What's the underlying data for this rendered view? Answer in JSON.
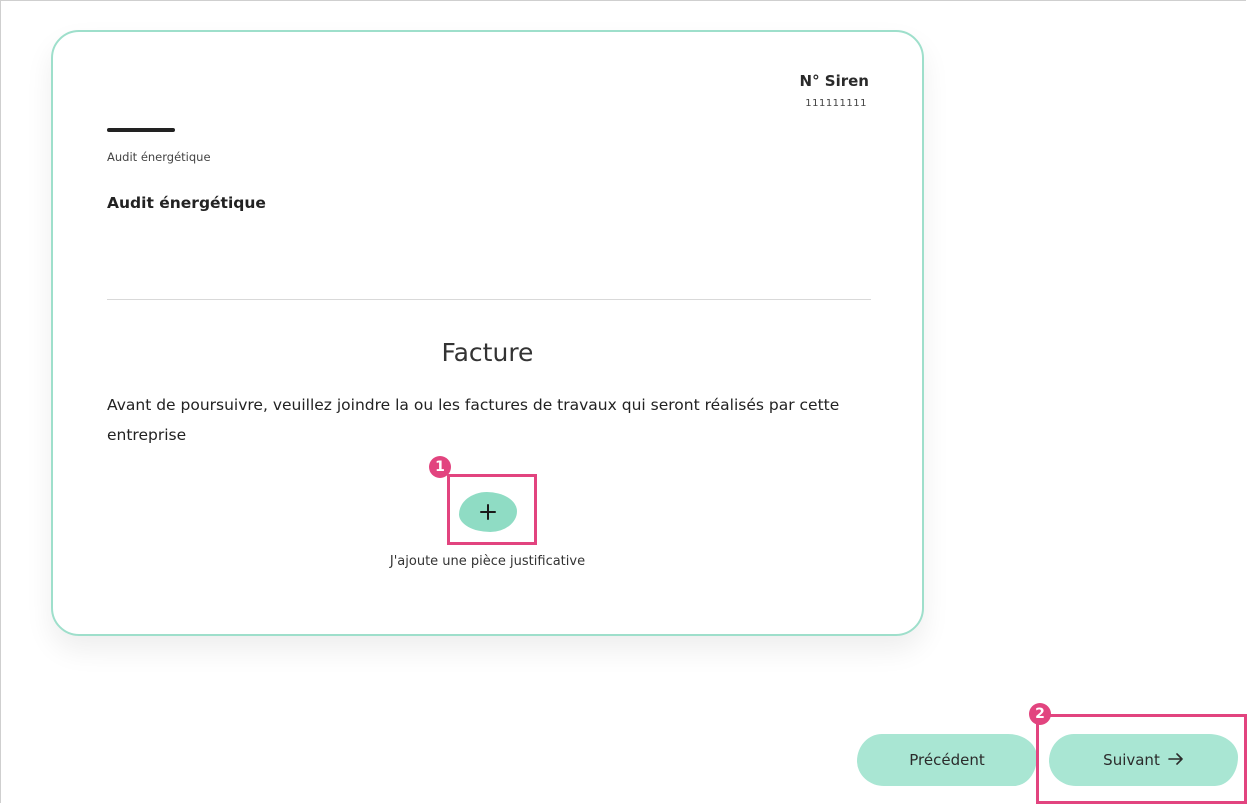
{
  "card": {
    "siren_label": "N° Siren",
    "siren_value": "111111111",
    "category_small": "Audit énergétique",
    "category_main": "Audit énergétique"
  },
  "facture": {
    "title": "Facture",
    "instruction": "Avant de poursuivre, veuillez joindre la ou les factures de travaux qui seront réalisés par cette entreprise",
    "add_label": "J'ajoute une pièce justificative",
    "add_icon": "plus-icon"
  },
  "annotations": {
    "marker_1": "1",
    "marker_2": "2",
    "highlight_color": "#e2447f"
  },
  "navigation": {
    "previous_label": "Précédent",
    "next_label": "Suivant",
    "next_icon": "arrow-right-icon"
  },
  "colors": {
    "accent": "#8fdcc4",
    "card_border": "#9edfcb",
    "button_bg": "#a9e6d3"
  }
}
